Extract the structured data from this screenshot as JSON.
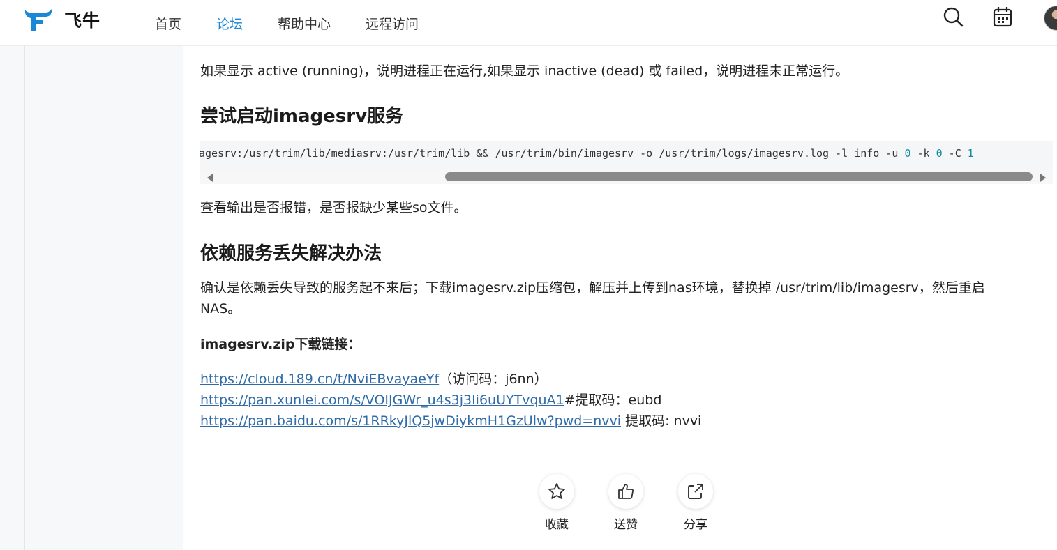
{
  "header": {
    "logo_text": "飞牛",
    "nav": [
      "首页",
      "论坛",
      "帮助中心",
      "远程访问"
    ],
    "active_nav": "论坛",
    "accent_color": "#1a88d6"
  },
  "article": {
    "intro": "如果显示 active (running)，说明进程正在运行,如果显示 inactive (dead) 或 failed，说明进程未正常运行。",
    "h_start": "尝试启动imagesrv服务",
    "code_part1": "agesrv:/usr/trim/lib/mediasrv:/usr/trim/lib && /usr/trim/bin/imagesrv -o /usr/trim/logs/imagesrv.log -l info -u ",
    "code_num1": "0",
    "code_part2": " -k ",
    "code_num2": "0",
    "code_part3": " -C ",
    "code_num3": "1",
    "check_output": "查看输出是否报错，是否报缺少某些so文件。",
    "h_missing": "依赖服务丢失解决办法",
    "fix_line1": "确认是依赖丢失导致的服务起不来后；下载imagesrv.zip压缩包，解压并上传到nas环境，替换掉 /usr/trim/lib/imagesrv，然后重启",
    "fix_line2": "NAS。",
    "download_label": "imagesrv.zip下载链接：",
    "links": [
      {
        "url": "https://cloud.189.cn/t/NviEBvayaeYf",
        "note": "（访问码：j6nn）"
      },
      {
        "url": "https://pan.xunlei.com/s/VOIJGWr_u4s3j3Ii6uUYTvquA1",
        "note": "#提取码：eubd"
      },
      {
        "url": "https://pan.baidu.com/s/1RRkyJlQ5jwDiykmH1GzUlw?pwd=nvvi",
        "note": " 提取码: nvvi"
      }
    ]
  },
  "actions": {
    "favorite": "收藏",
    "like": "送赞",
    "share": "分享"
  }
}
